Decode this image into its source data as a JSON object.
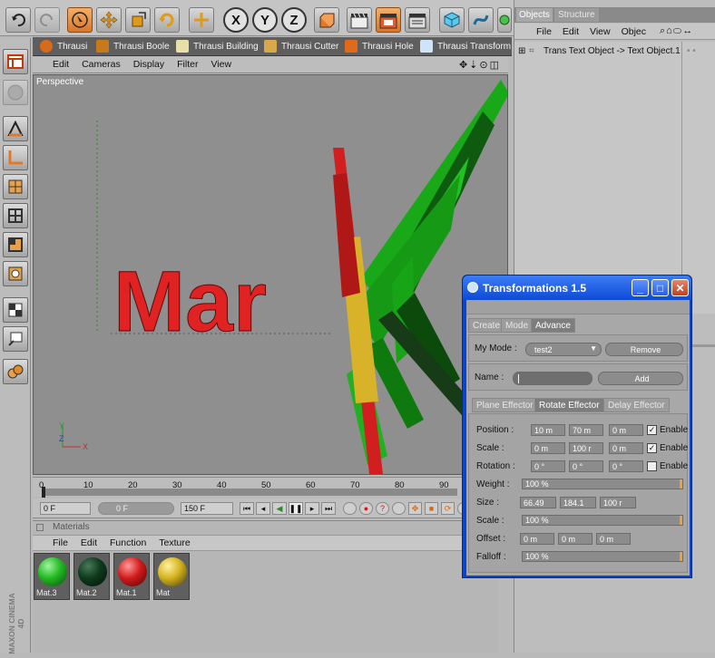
{
  "toolbar": {
    "x_label": "X",
    "y_label": "Y",
    "z_label": "Z"
  },
  "plugins": [
    {
      "label": "Thrausi"
    },
    {
      "label": "Thrausi Boole"
    },
    {
      "label": "Thrausi Building"
    },
    {
      "label": "Thrausi Cutter"
    },
    {
      "label": "Thrausi Hole"
    },
    {
      "label": "Thrausi Transform"
    }
  ],
  "viewport": {
    "menu": [
      "Edit",
      "Cameras",
      "Display",
      "Filter",
      "View"
    ],
    "view_name": "Perspective",
    "axis_x": "X",
    "axis_y": "Y",
    "axis_z": "Z",
    "scene_text": "Mar"
  },
  "objects_panel": {
    "tabs": [
      "Objects",
      "Structure"
    ],
    "menu": [
      "File",
      "Edit",
      "View",
      "Objec"
    ],
    "item": "Trans Text Object -> Text Object.1"
  },
  "timeline": {
    "ticks": [
      "0",
      "10",
      "20",
      "30",
      "40",
      "50",
      "60",
      "70",
      "80",
      "90"
    ],
    "current_frame": "0 F",
    "start_frame": "0 F",
    "end_frame": "150 F"
  },
  "materials": {
    "title": "Materials",
    "menu": [
      "File",
      "Edit",
      "Function",
      "Texture"
    ],
    "items": [
      {
        "label": "Mat.3",
        "color": "#22b822"
      },
      {
        "label": "Mat.2",
        "color": "#0e3a1c"
      },
      {
        "label": "Mat.1",
        "color": "#d11a1a"
      },
      {
        "label": "Mat",
        "color": "#d2b21e"
      }
    ]
  },
  "brand": "MAXON CINEMA 4D",
  "dialog": {
    "title": "Transformations 1.5",
    "tabs": [
      "Create",
      "Mode",
      "Advance"
    ],
    "my_mode_label": "My Mode :",
    "my_mode_value": "test2",
    "remove_label": "Remove",
    "name_label": "Name :",
    "name_value": "",
    "add_label": "Add",
    "effector_tabs": [
      "Plane Effector",
      "Rotate Effector",
      "Delay Effector"
    ],
    "rows": {
      "position": {
        "label": "Position :",
        "v1": "10 m",
        "v2": "70 m",
        "v3": "0 m",
        "enable": "Enable",
        "checked": true
      },
      "scale": {
        "label": "Scale :",
        "v1": "0 m",
        "v2": "100 r",
        "v3": "0 m",
        "enable": "Enable",
        "checked": true
      },
      "rotation": {
        "label": "Rotation :",
        "v1": "0 °",
        "v2": "0 °",
        "v3": "0 °",
        "enable": "Enable",
        "checked": false
      },
      "weight": {
        "label": "Weight :",
        "value": "100 %"
      },
      "size": {
        "label": "Size :",
        "v1": "66.49",
        "v2": "184.1",
        "v3": "100 r"
      },
      "scale2": {
        "label": "Scale :",
        "value": "100 %"
      },
      "offset": {
        "label": "Offset :",
        "v1": "0 m",
        "v2": "0 m",
        "v3": "0 m"
      },
      "falloff": {
        "label": "Falloff :",
        "value": "100 %"
      }
    }
  }
}
